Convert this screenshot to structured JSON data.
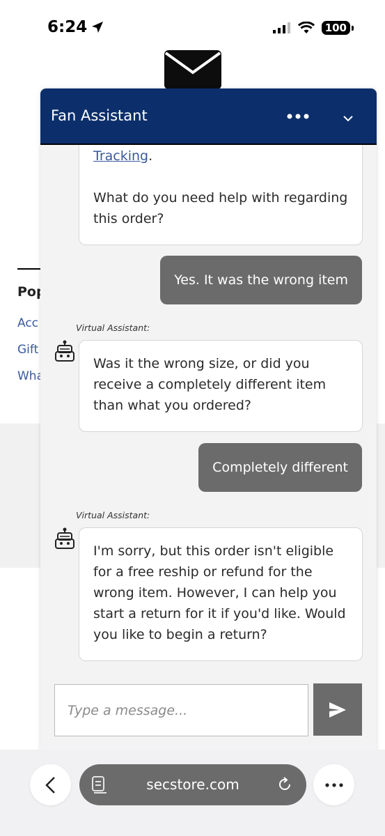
{
  "status_bar": {
    "time": "6:24",
    "battery": "100"
  },
  "background_page": {
    "heading": "Pop",
    "links": [
      "Acc",
      "Gift",
      "Wha"
    ]
  },
  "chat": {
    "title": "Fan Assistant",
    "messages": [
      {
        "sender": "bot",
        "link_text": "Tracking",
        "text_after_link": ".",
        "text": "What do you need help with regarding this order?"
      },
      {
        "sender": "user",
        "text": "Yes. It was the wrong item"
      },
      {
        "sender": "bot",
        "label": "Virtual Assistant:",
        "text": "Was it the wrong size, or did you receive a completely different item than what you ordered?"
      },
      {
        "sender": "user",
        "text": "Completely different"
      },
      {
        "sender": "bot",
        "label": "Virtual Assistant:",
        "text": "I'm sorry, but this order isn't eligible for a free reship or refund for the wrong item. However, I can help you start a return for it if you'd like. Would you like to begin a return?"
      }
    ],
    "input_placeholder": "Type a message..."
  },
  "browser": {
    "url": "secstore.com"
  },
  "colors": {
    "header_bg": "#0c2f6b",
    "user_bubble": "#6b6b6b",
    "link": "#3a5a9c"
  }
}
